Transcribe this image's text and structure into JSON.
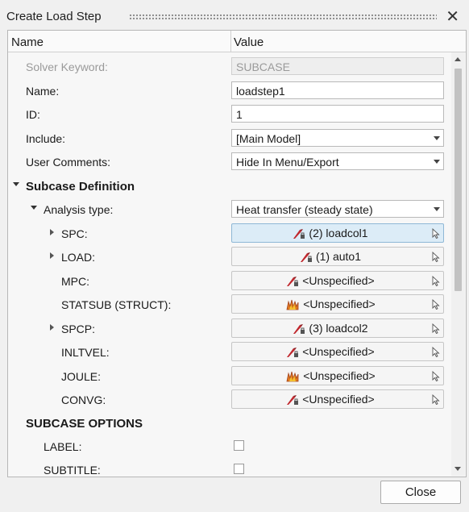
{
  "window": {
    "title": "Create Load Step",
    "close_glyph": "✕"
  },
  "header": {
    "name": "Name",
    "value": "Value"
  },
  "fields": {
    "solver_keyword": {
      "label": "Solver Keyword:",
      "value": "SUBCASE"
    },
    "name": {
      "label": "Name:",
      "value": "loadstep1"
    },
    "id": {
      "label": "ID:",
      "value": "1"
    },
    "include": {
      "label": "Include:",
      "value": "[Main Model]"
    },
    "user_comments": {
      "label": "User Comments:",
      "value": "Hide In Menu/Export"
    }
  },
  "subcase": {
    "label": "Subcase Definition",
    "analysis_type": {
      "label": "Analysis type:",
      "value": "Heat transfer (steady state)"
    },
    "items": [
      {
        "label": "SPC:",
        "value": "(2) loadcol1",
        "icon": "loadcol-icon"
      },
      {
        "label": "LOAD:",
        "value": "(1) auto1",
        "icon": "loadcol-icon"
      },
      {
        "label": "MPC:",
        "value": "<Unspecified>",
        "icon": "loadcol-icon"
      },
      {
        "label": "STATSUB (STRUCT):",
        "value": "<Unspecified>",
        "icon": "loadstep-icon"
      },
      {
        "label": "SPCP:",
        "value": "(3) loadcol2",
        "icon": "loadcol-icon"
      },
      {
        "label": "INLTVEL:",
        "value": "<Unspecified>",
        "icon": "loadcol-icon"
      },
      {
        "label": "JOULE:",
        "value": "<Unspecified>",
        "icon": "loadstep-icon"
      },
      {
        "label": "CONVG:",
        "value": "<Unspecified>",
        "icon": "loadcol-icon"
      }
    ]
  },
  "options": {
    "label": "SUBCASE OPTIONS",
    "items": [
      {
        "label": "LABEL:",
        "checked": false
      },
      {
        "label": "SUBTITLE:",
        "checked": false
      }
    ]
  },
  "footer": {
    "close_label": "Close"
  },
  "colors": {
    "selected_bg": "#dcecf7",
    "icon_red": "#c0272d"
  }
}
